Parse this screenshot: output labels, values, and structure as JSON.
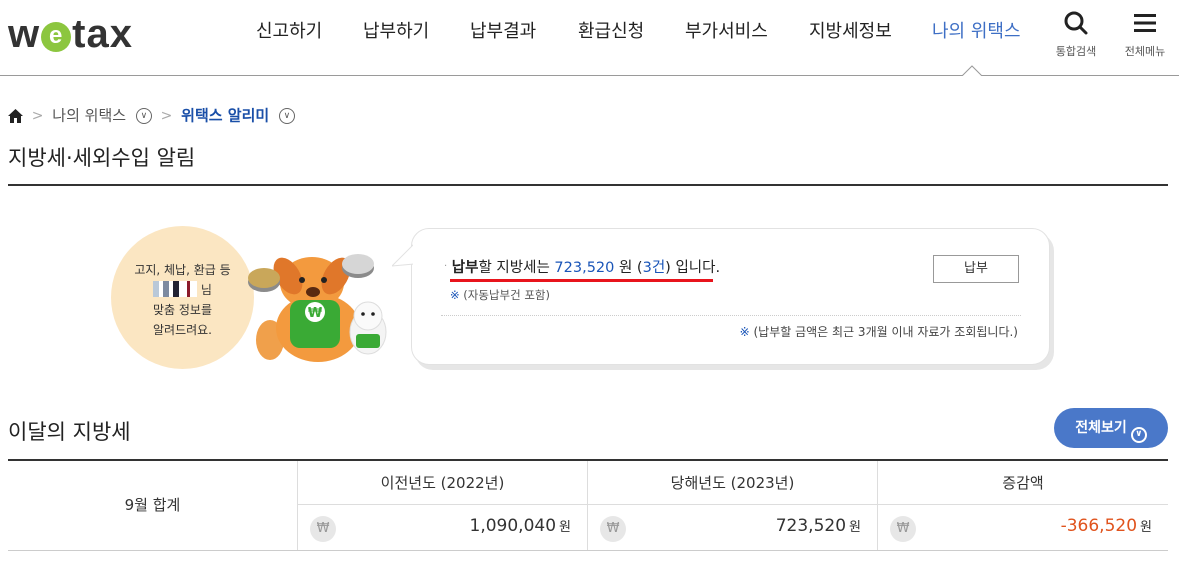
{
  "logo": {
    "prefix": "w",
    "mid": "e",
    "suffix": "tax"
  },
  "nav": [
    {
      "label": "신고하기"
    },
    {
      "label": "납부하기"
    },
    {
      "label": "납부결과"
    },
    {
      "label": "환급신청"
    },
    {
      "label": "부가서비스"
    },
    {
      "label": "지방세정보"
    },
    {
      "label": "나의 위택스",
      "active": true
    }
  ],
  "header_icons": {
    "search_label": "통합검색",
    "menu_label": "전체메뉴"
  },
  "breadcrumb": {
    "level1": "나의 위택스",
    "current": "위택스 알리미"
  },
  "page_title": "지방세·세외수입 알림",
  "notice": {
    "circle_line1": "고지, 체납, 환급 등",
    "circle_suffix": "님",
    "circle_line3": "맞춤 정보를",
    "circle_line4": "알려드려요.",
    "pay_word": "납부",
    "line_mid": "할 지방세는 ",
    "amount": "723,520",
    "line_unit": " 원 (",
    "count": "3건",
    "line_end": ") 입니다.",
    "sub_mark": "※",
    "sub_text": " (자동납부건 포함)",
    "pay_button": "납부",
    "note_mark": "※",
    "note_text": " (납부할 금액은 최근 3개월 이내 자료가 조회됩니다.)"
  },
  "monthly": {
    "title": "이달의 지방세",
    "view_all": "전체보기",
    "row_label": "9월 합계",
    "columns": [
      "이전년도 (2022년)",
      "당해년도 (2023년)",
      "증감액"
    ],
    "values": [
      "1,090,040",
      "723,520",
      "-366,520"
    ],
    "unit": "원",
    "currency_symbol": "₩"
  },
  "colors": {
    "accent": "#4a78c9",
    "active_nav": "#3e6fc5",
    "highlight": "#e8141c",
    "negative": "#e0531d"
  }
}
